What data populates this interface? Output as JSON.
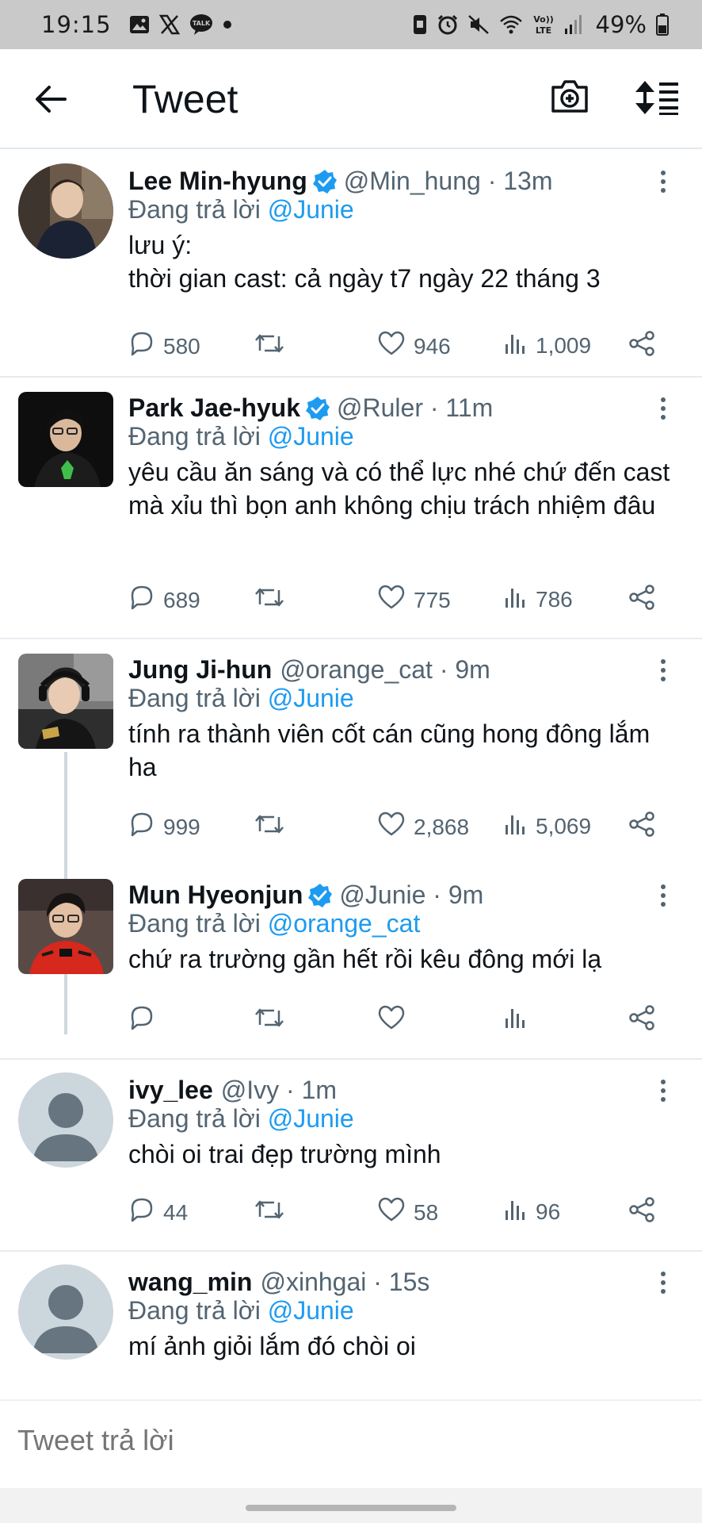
{
  "status_bar": {
    "time": "19:15",
    "battery": "49%",
    "icons": [
      "gallery-icon",
      "x-icon",
      "talk-icon",
      "dot-icon",
      "note-icon",
      "alarm-icon",
      "mute-icon",
      "wifi-icon",
      "volte-icon",
      "signal-icon",
      "battery-icon"
    ]
  },
  "header": {
    "title": "Tweet"
  },
  "colors": {
    "accent": "#1d9bf0",
    "text": "#0f1419",
    "secondary": "#536471",
    "divider": "#e6ecf0"
  },
  "tweets": [
    {
      "name": "Lee Min-hyung",
      "verified": true,
      "handle_time": "@Min_hung · 13m",
      "reply_prefix": "Đang trả lời ",
      "reply_to": "@Junie",
      "body": "lưu ý:\nthời gian cast: cả ngày t7 ngày 22 tháng 3",
      "replies": "580",
      "retweets": "",
      "likes": "946",
      "views": "1,009"
    },
    {
      "name": "Park Jae-hyuk",
      "verified": true,
      "handle_time": "@Ruler · 11m",
      "reply_prefix": "Đang trả lời ",
      "reply_to": "@Junie",
      "body": "yêu cầu ăn sáng và có thể lực nhé chứ đến cast mà xỉu thì bọn anh không chịu trách nhiệm đâu",
      "replies": "689",
      "retweets": "",
      "likes": "775",
      "views": "786"
    },
    {
      "name": "Jung Ji-hun",
      "verified": false,
      "handle_time": "@orange_cat · 9m",
      "reply_prefix": "Đang trả lời ",
      "reply_to": "@Junie",
      "body": "tính ra thành viên cốt cán cũng hong đông lắm ha",
      "replies": "999",
      "retweets": "",
      "likes": "2,868",
      "views": "5,069"
    },
    {
      "name": "Mun Hyeonjun",
      "verified": true,
      "handle_time": "@Junie · 9m",
      "reply_prefix": "Đang trả lời ",
      "reply_to": "@orange_cat",
      "body": "chứ ra trường gần hết rồi kêu đông mới lạ",
      "replies": "",
      "retweets": "",
      "likes": "",
      "views": ""
    },
    {
      "name": "ivy_lee",
      "verified": false,
      "handle_time": "@Ivy · 1m",
      "reply_prefix": "Đang trả lời ",
      "reply_to": "@Junie",
      "body": "chòi oi trai đẹp trường mình",
      "replies": "44",
      "retweets": "",
      "likes": "58",
      "views": "96"
    },
    {
      "name": "wang_min",
      "verified": false,
      "handle_time": "@xinhgai · 15s",
      "reply_prefix": "Đang trả lời ",
      "reply_to": "@Junie",
      "body": "mí ảnh giỏi lắm đó chòi oi"
    }
  ],
  "reply_box": {
    "placeholder": "Tweet trả lời"
  }
}
